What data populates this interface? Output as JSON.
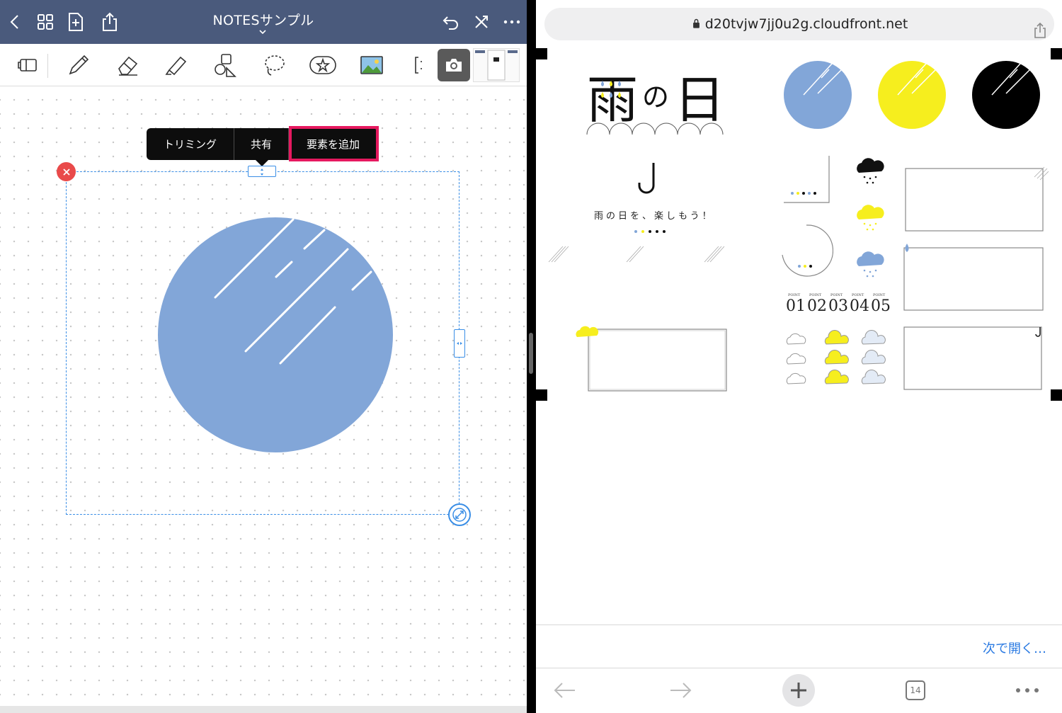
{
  "left_app": {
    "title": "NOTESサンプル",
    "context_menu": {
      "trim": "トリミング",
      "share": "共有",
      "add_element": "要素を追加"
    },
    "circle_color": "#82a6d8",
    "selection_color": "#3a8ee6",
    "highlight_color": "#e6195f"
  },
  "browser": {
    "url": "d20tvjw7jj0u2g.cloudfront.net",
    "open_next": "次で開く…",
    "tab_count": "14",
    "sheet": {
      "title_rain": "雨",
      "title_no": "の",
      "title_day": "日",
      "tagline": "雨の日を、楽しもう！",
      "point_label": "POINT",
      "points": [
        "01",
        "02",
        "03",
        "04",
        "05"
      ]
    }
  },
  "colors": {
    "blue": "#82a6d8",
    "yellow": "#f6ee1e",
    "black": "#000000",
    "nav": "#4a5a7c",
    "link": "#2a7ae2"
  }
}
